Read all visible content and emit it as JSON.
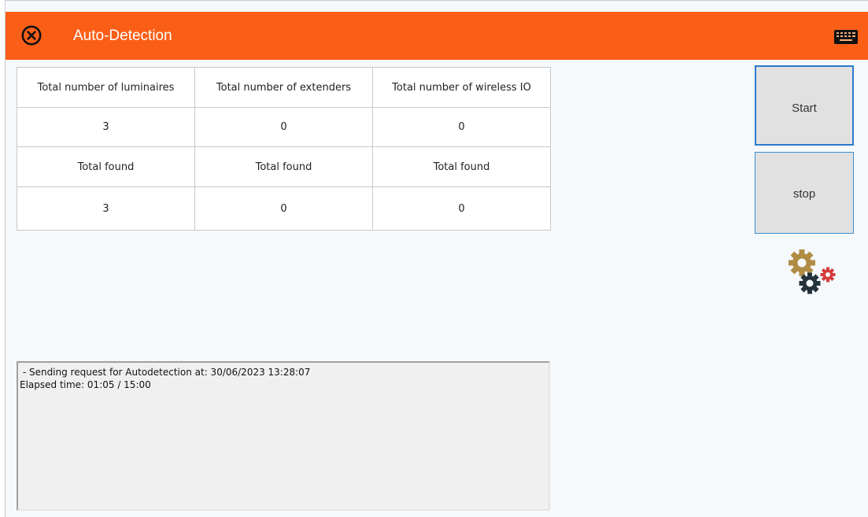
{
  "window": {
    "title": "Auto-Detection"
  },
  "icons": {
    "close": "close-circle-icon",
    "keyboard": "keyboard-icon",
    "gears": "gears-icon"
  },
  "colors": {
    "titlebar": "#fb5f17",
    "button_border": "#2b7bcc",
    "gear_gold": "#b08c44",
    "gear_dark": "#24323c",
    "gear_red": "#d63b3b"
  },
  "table": {
    "headers": [
      "Total number of luminaires",
      "Total number of extenders",
      "Total number of wireless IO"
    ],
    "totals": [
      "3",
      "0",
      "0"
    ],
    "found_labels": [
      "Total found",
      "Total found",
      "Total found"
    ],
    "found": [
      "3",
      "0",
      "0"
    ]
  },
  "buttons": {
    "start": "Start",
    "stop": "stop"
  },
  "log": {
    "lines": [
      " - Sending request for Autodetection at: 30/06/2023 13:28:07",
      "Elapsed time: 01:05 / 15:00"
    ]
  }
}
